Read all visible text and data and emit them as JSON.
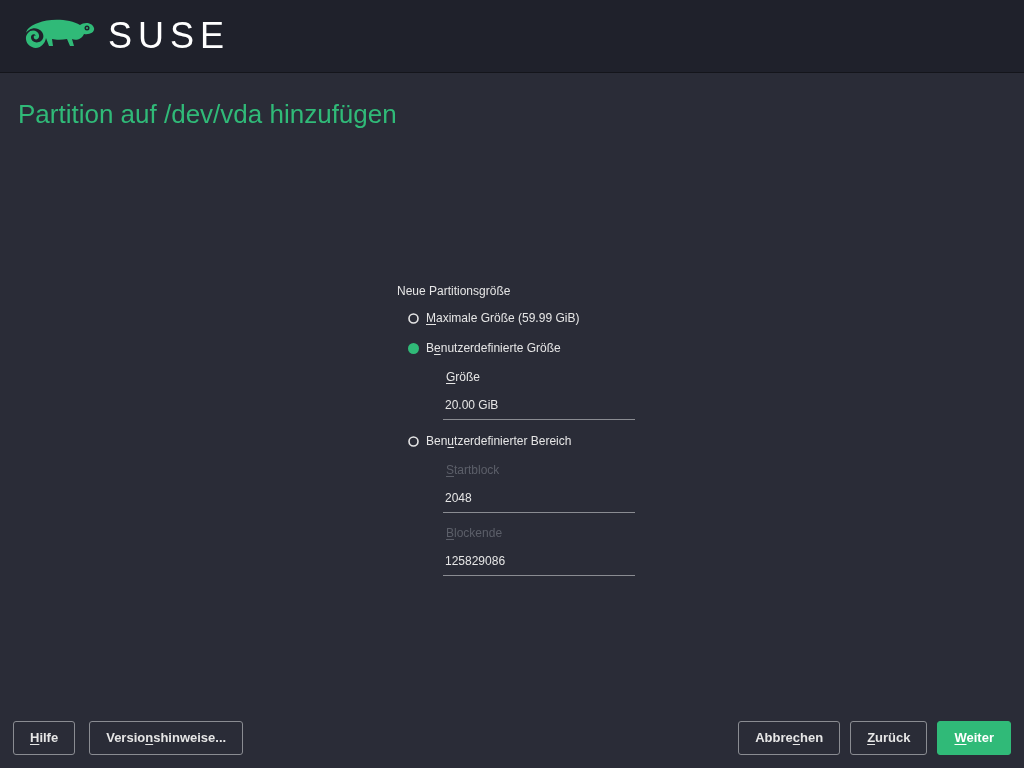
{
  "header": {
    "logo_text": "SUSE"
  },
  "title": "Partition auf /dev/vda hinzufügen",
  "group": {
    "label": "Neue Partitionsgröße",
    "options": [
      {
        "label": {
          "key": "M",
          "after": "aximale Größe (59.99 GiB)"
        },
        "selected": false
      },
      {
        "label": {
          "before": "B",
          "key": "e",
          "after": "nutzerdefinierte Größe"
        },
        "selected": true,
        "fields": [
          {
            "label": {
              "key": "G",
              "after": "röße"
            },
            "value": "20.00 GiB",
            "disabled": false
          }
        ]
      },
      {
        "label": {
          "before": "Ben",
          "key": "u",
          "after": "tzerdefinierter Bereich"
        },
        "selected": false,
        "fields": [
          {
            "label": {
              "key": "S",
              "after": "tartblock"
            },
            "value": "2048",
            "disabled": true
          },
          {
            "label": {
              "key": "B",
              "after": "lockende"
            },
            "value": "125829086",
            "disabled": true
          }
        ]
      }
    ]
  },
  "buttons_left": [
    {
      "label": {
        "key": "H",
        "after": "ilfe"
      },
      "primary": false
    },
    {
      "label": {
        "before": "Versio",
        "key": "n",
        "after": "shinweise..."
      },
      "primary": false
    }
  ],
  "buttons_right": [
    {
      "label": {
        "before": "Abbre",
        "key": "c",
        "after": "hen"
      },
      "primary": false
    },
    {
      "label": {
        "key": "Z",
        "after": "urück"
      },
      "primary": false
    },
    {
      "label": {
        "key": "W",
        "after": "eiter"
      },
      "primary": true
    }
  ]
}
